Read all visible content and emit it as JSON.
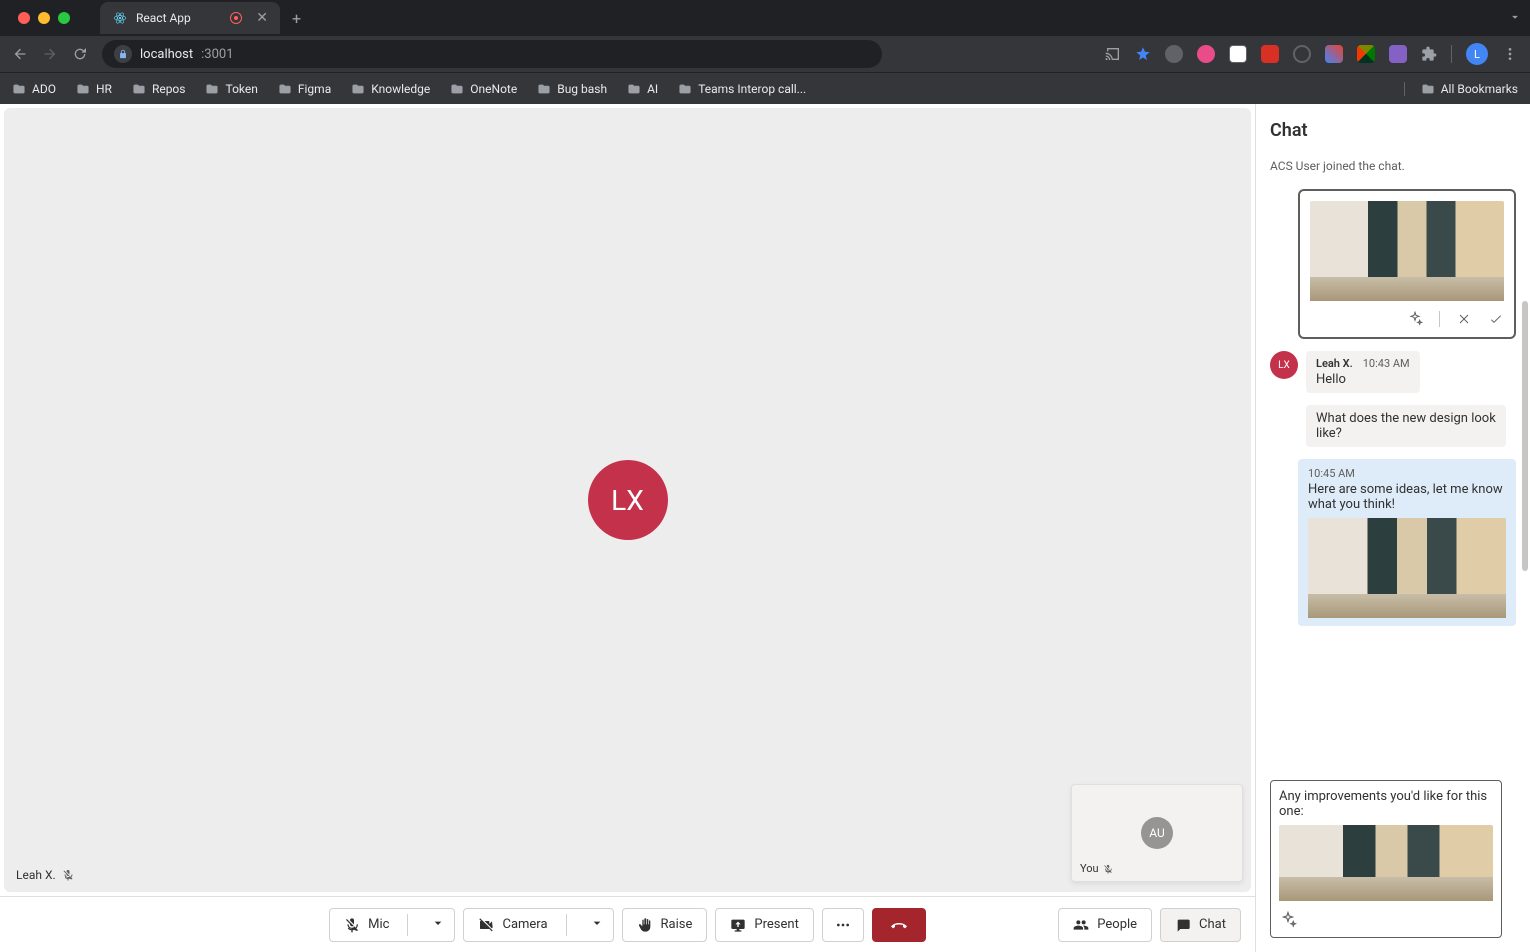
{
  "browser": {
    "tab_title": "React App",
    "url_host": "localhost",
    "url_path": ":3001",
    "avatar_letter": "L",
    "bookmarks": [
      "ADO",
      "HR",
      "Repos",
      "Token",
      "Figma",
      "Knowledge",
      "OneNote",
      "Bug bash",
      "AI",
      "Teams Interop call..."
    ],
    "all_bookmarks": "All Bookmarks"
  },
  "call": {
    "main_avatar": "LX",
    "main_name": "Leah X.",
    "pip_avatar": "AU",
    "pip_label": "You"
  },
  "chat": {
    "title": "Chat",
    "system_msg": "ACS User joined the chat.",
    "msg1": {
      "author": "Leah X.",
      "time": "10:43 AM",
      "text": "Hello",
      "avatar": "LX"
    },
    "msg2": {
      "text": "What does the new design look like?"
    },
    "msg3": {
      "time": "10:45 AM",
      "text": "Here are some ideas, let me know what you think!"
    },
    "compose": {
      "text": "Any improvements you'd like for this one:"
    }
  },
  "toolbar": {
    "mic": "Mic",
    "camera": "Camera",
    "raise": "Raise",
    "present": "Present",
    "people": "People",
    "chat": "Chat"
  }
}
